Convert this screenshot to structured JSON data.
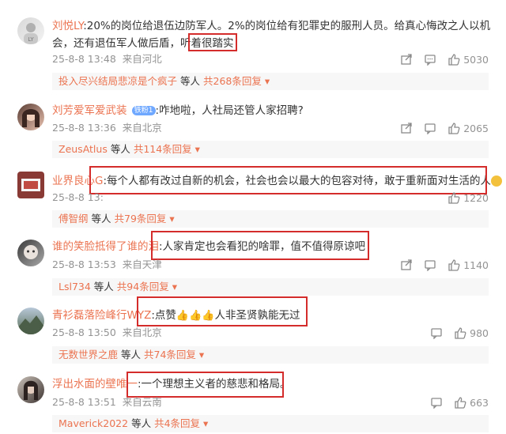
{
  "comments": [
    {
      "username": "刘悦LY",
      "text1": ":20%的岗位给退伍边防军人。2%的岗位给有犯罪史的服刑人员。给真心悔改之人以机",
      "text2a": "会，还有退伍军人做后盾，",
      "text2b": "听着很踏实",
      "time": "25-8-8 13:48",
      "location": "来自河北",
      "likes": "5030",
      "reply_prefix": "投入尽兴结局悲凉是个疯子",
      "reply_mid": "等人",
      "reply_count": "共268条回复"
    },
    {
      "username": "刘芳爱军爱武装",
      "badge": "铁粉1",
      "text1": ":咋地啦，人社局还管人家招聘?",
      "time": "25-8-8 13:36",
      "location": "来自北京",
      "likes": "2065",
      "reply_prefix": "ZeusAtlus",
      "reply_mid": "等人",
      "reply_count": "共114条回复"
    },
    {
      "username": "业界良心G",
      "text1": ":每个人都有改过自新的机会，社会也会以最大的包容对待，敢于重新面对生活的人",
      "time": "25-8-8 13:",
      "location": "",
      "likes": "1220",
      "reply_prefix": "傅智纲",
      "reply_mid": "等人",
      "reply_count": "共79条回复"
    },
    {
      "username": "谁的笑脸抵得了谁的泪",
      "text1": ":人家肯定也会看犯的啥罪，值不值得原谅吧",
      "time": "25-8-8 13:53",
      "location": "来自天津",
      "likes": "1140",
      "reply_prefix": "Lsl734",
      "reply_mid": "等人",
      "reply_count": "共94条回复"
    },
    {
      "username": "青衫磊落险峰行WYZ",
      "text1": ":点赞",
      "text1b": "人非圣贤孰能无过",
      "time": "25-8-8 13:50",
      "location": "来自北京",
      "likes": "980",
      "reply_prefix": "无数世界之鹿",
      "reply_mid": "等人",
      "reply_count": "共74条回复"
    },
    {
      "username": "浮出水面的壁唯一",
      "text1": ":一个理想主义者的慈悲和格局。",
      "time": "25-8-8 13:51",
      "location": "来自云南",
      "likes": "663",
      "reply_prefix": "Maverick2022",
      "reply_mid": "等人",
      "reply_count": "共4条回复"
    }
  ],
  "icons": {
    "share": "share-icon",
    "comment": "comment-icon",
    "like": "like-icon",
    "expand": "caret-down-icon"
  },
  "colors": {
    "username": "#eb7350",
    "highlight_box": "#d42b2b",
    "meta": "#939393"
  }
}
